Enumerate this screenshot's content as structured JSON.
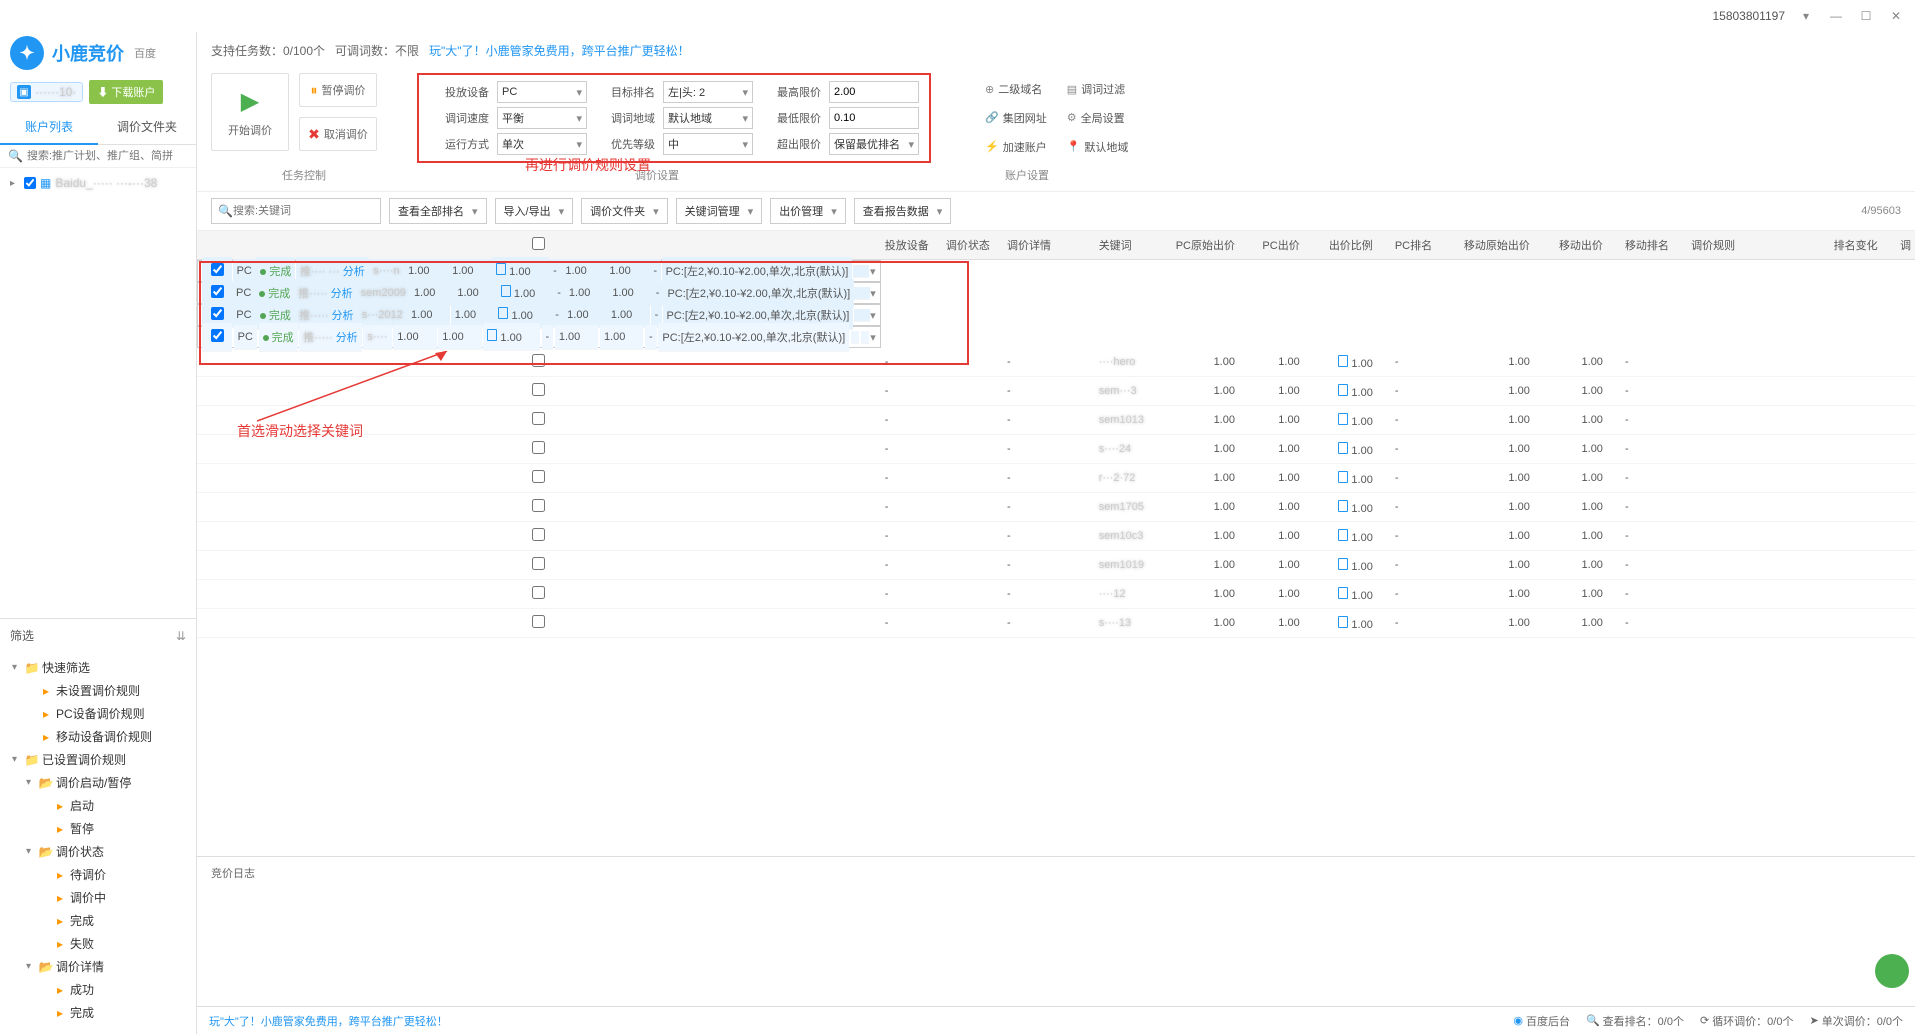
{
  "titlebar": {
    "phone": "15803801197"
  },
  "logo": {
    "text": "小鹿竞价",
    "sup": "百度"
  },
  "account": {
    "masked": "······10·",
    "download_btn": "下载账户"
  },
  "side_tabs": {
    "tab1": "账户列表",
    "tab2": "调价文件夹"
  },
  "side_search_ph": "搜索:推广计划、推广组、简拼",
  "tree": {
    "item1": "Baidu_····· ···-···38"
  },
  "filter_header": "筛选",
  "filter_tree": {
    "n1": "快速筛选",
    "n1a": "未设置调价规则",
    "n1b": "PC设备调价规则",
    "n1c": "移动设备调价规则",
    "n2": "已设置调价规则",
    "n2a": "调价启动/暂停",
    "n2a1": "启动",
    "n2a2": "暂停",
    "n2b": "调价状态",
    "n2b1": "待调价",
    "n2b2": "调价中",
    "n2b3": "完成",
    "n2b4": "失败",
    "n2c": "调价详情",
    "n2c1": "成功",
    "n2c2": "完成"
  },
  "topinfo": {
    "tasks": "支持任务数：0/100个",
    "words": "可调词数：不限",
    "promo": "玩\"大\"了！小鹿管家免费用，跨平台推广更轻松！"
  },
  "ctrl": {
    "start": "开始调价",
    "pause": "暂停调价",
    "cancel": "取消调价"
  },
  "settings": {
    "l1": "投放设备",
    "v1": "PC",
    "l2": "目标排名",
    "v2": "左|头: 2",
    "l3": "最高限价",
    "v3": "2.00",
    "l4": "调词速度",
    "v4": "平衡",
    "l5": "调词地域",
    "v5": "默认地域",
    "l6": "最低限价",
    "v6": "0.10",
    "l7": "运行方式",
    "v7": "单次",
    "l8": "优先等级",
    "v8": "中",
    "l9": "超出限价",
    "v9": "保留最优排名"
  },
  "acct_set": {
    "a1": "二级域名",
    "a2": "调词过滤",
    "a3": "集团网址",
    "a4": "全局设置",
    "a5": "加速账户",
    "a6": "默认地域"
  },
  "sections": {
    "s1": "任务控制",
    "s2": "调价设置",
    "s3": "账户设置"
  },
  "annotation1": "再进行调价规则设置",
  "toolbar": {
    "search_ph": "搜索:关键词",
    "b1": "查看全部排名",
    "b2": "导入/导出",
    "b3": "调价文件夹",
    "b4": "关键词管理",
    "b5": "出价管理",
    "b6": "查看报告数据",
    "count": "4/95603"
  },
  "cols": {
    "c1": "投放设备",
    "c2": "调价状态",
    "c3": "调价详情",
    "c4": "关键词",
    "c5": "PC原始出价",
    "c6": "PC出价",
    "c7": "出价比例",
    "c8": "PC排名",
    "c9": "移动原始出价",
    "c10": "移动出价",
    "c11": "移动排名",
    "c12": "调价规则",
    "c13": "排名变化",
    "c14": "调"
  },
  "rows": [
    {
      "sel": true,
      "device": "PC",
      "status": "完成",
      "detail": "推···· ···",
      "analysis": "分析",
      "kw": "s····n",
      "pc_orig": "1.00",
      "pc_bid": "1.00",
      "ratio": "1.00",
      "pc_rank": "-",
      "m_orig": "1.00",
      "m_bid": "1.00",
      "m_rank": "-",
      "rule": "PC:[左2,¥0.10-¥2.00,单次,北京(默认)]"
    },
    {
      "sel": true,
      "device": "PC",
      "status": "完成",
      "detail": "推·····",
      "analysis": "分析",
      "kw": "sem2009",
      "pc_orig": "1.00",
      "pc_bid": "1.00",
      "ratio": "1.00",
      "pc_rank": "-",
      "m_orig": "1.00",
      "m_bid": "1.00",
      "m_rank": "-",
      "rule": "PC:[左2,¥0.10-¥2.00,单次,北京(默认)]"
    },
    {
      "sel": true,
      "device": "PC",
      "status": "完成",
      "detail": "推·····",
      "analysis": "分析",
      "kw": "s···2012",
      "pc_orig": "1.00",
      "pc_bid": "1.00",
      "ratio": "1.00",
      "pc_rank": "-",
      "m_orig": "1.00",
      "m_bid": "1.00",
      "m_rank": "-",
      "rule": "PC:[左2,¥0.10-¥2.00,单次,北京(默认)]"
    },
    {
      "sel": true,
      "device": "PC",
      "status": "完成",
      "detail": "推·····",
      "analysis": "分析",
      "kw": "s····",
      "pc_orig": "1.00",
      "pc_bid": "1.00",
      "ratio": "1.00",
      "pc_rank": "-",
      "m_orig": "1.00",
      "m_bid": "1.00",
      "m_rank": "-",
      "rule": "PC:[左2,¥0.10-¥2.00,单次,北京(默认)]"
    },
    {
      "sel": false,
      "device": "-",
      "status": "",
      "detail": "-",
      "analysis": "",
      "kw": "····hero",
      "pc_orig": "1.00",
      "pc_bid": "1.00",
      "ratio": "1.00",
      "pc_rank": "-",
      "m_orig": "1.00",
      "m_bid": "1.00",
      "m_rank": "-",
      "rule": ""
    },
    {
      "sel": false,
      "device": "-",
      "status": "",
      "detail": "-",
      "analysis": "",
      "kw": "sem···3",
      "pc_orig": "1.00",
      "pc_bid": "1.00",
      "ratio": "1.00",
      "pc_rank": "-",
      "m_orig": "1.00",
      "m_bid": "1.00",
      "m_rank": "-",
      "rule": ""
    },
    {
      "sel": false,
      "device": "-",
      "status": "",
      "detail": "-",
      "analysis": "",
      "kw": "sem1013",
      "pc_orig": "1.00",
      "pc_bid": "1.00",
      "ratio": "1.00",
      "pc_rank": "-",
      "m_orig": "1.00",
      "m_bid": "1.00",
      "m_rank": "-",
      "rule": ""
    },
    {
      "sel": false,
      "device": "-",
      "status": "",
      "detail": "-",
      "analysis": "",
      "kw": "s····24",
      "pc_orig": "1.00",
      "pc_bid": "1.00",
      "ratio": "1.00",
      "pc_rank": "-",
      "m_orig": "1.00",
      "m_bid": "1.00",
      "m_rank": "-",
      "rule": ""
    },
    {
      "sel": false,
      "device": "-",
      "status": "",
      "detail": "-",
      "analysis": "",
      "kw": "r···2·72",
      "pc_orig": "1.00",
      "pc_bid": "1.00",
      "ratio": "1.00",
      "pc_rank": "-",
      "m_orig": "1.00",
      "m_bid": "1.00",
      "m_rank": "-",
      "rule": ""
    },
    {
      "sel": false,
      "device": "-",
      "status": "",
      "detail": "-",
      "analysis": "",
      "kw": "sem1705",
      "pc_orig": "1.00",
      "pc_bid": "1.00",
      "ratio": "1.00",
      "pc_rank": "-",
      "m_orig": "1.00",
      "m_bid": "1.00",
      "m_rank": "-",
      "rule": ""
    },
    {
      "sel": false,
      "device": "-",
      "status": "",
      "detail": "-",
      "analysis": "",
      "kw": "sem10c3",
      "pc_orig": "1.00",
      "pc_bid": "1.00",
      "ratio": "1.00",
      "pc_rank": "-",
      "m_orig": "1.00",
      "m_bid": "1.00",
      "m_rank": "-",
      "rule": ""
    },
    {
      "sel": false,
      "device": "-",
      "status": "",
      "detail": "-",
      "analysis": "",
      "kw": "sem1019",
      "pc_orig": "1.00",
      "pc_bid": "1.00",
      "ratio": "1.00",
      "pc_rank": "-",
      "m_orig": "1.00",
      "m_bid": "1.00",
      "m_rank": "-",
      "rule": ""
    },
    {
      "sel": false,
      "device": "-",
      "status": "",
      "detail": "-",
      "analysis": "",
      "kw": "····12",
      "pc_orig": "1.00",
      "pc_bid": "1.00",
      "ratio": "1.00",
      "pc_rank": "-",
      "m_orig": "1.00",
      "m_bid": "1.00",
      "m_rank": "-",
      "rule": ""
    },
    {
      "sel": false,
      "device": "-",
      "status": "",
      "detail": "-",
      "analysis": "",
      "kw": "s····13",
      "pc_orig": "1.00",
      "pc_bid": "1.00",
      "ratio": "1.00",
      "pc_rank": "-",
      "m_orig": "1.00",
      "m_bid": "1.00",
      "m_rank": "-",
      "rule": ""
    }
  ],
  "annotation2": "首选滑动选择关键词",
  "log": {
    "title": "竞价日志"
  },
  "statusbar": {
    "promo": "玩\"大\"了！小鹿管家免费用，跨平台推广更轻松！",
    "backend": "百度后台",
    "s1": "查看排名：0/0个",
    "s2": "循环调价：0/0个",
    "s3": "单次调价：0/0个"
  }
}
